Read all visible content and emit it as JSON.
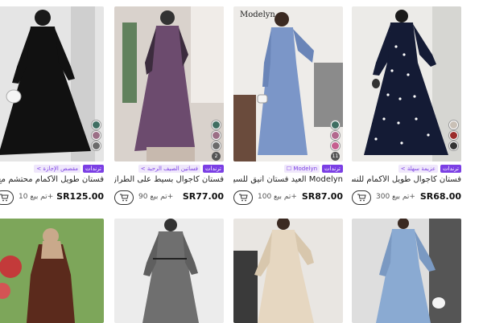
{
  "products": [
    {
      "title": "فستان طويل الأكمام محتشم مع طا...",
      "price": "SR125.00",
      "sold": "تم بيع 10+",
      "tags": [
        "ترندات",
        "مقصص الإجازة >"
      ],
      "swatch_colors": [
        "#3f6e62",
        "#9b6f86",
        "#6b6b6b"
      ],
      "more_label": "",
      "colors": {
        "bg": "#e5e5e5",
        "dress": "#111111"
      }
    },
    {
      "title": "فستان كاجوال بسيط على الطراز العربي...",
      "price": "SR77.00",
      "sold": "تم بيع 90+",
      "tags": [
        "ترندات",
        "فساتين الصيف الرحبة >"
      ],
      "swatch_colors": [
        "#3f6e62",
        "#9b6f86",
        "#6b6b6b"
      ],
      "more_label": "2",
      "colors": {
        "bg": "#d9d2cc",
        "dress": "#6c4b6e"
      }
    },
    {
      "title": "Modelyn العيد فستان أنيق للسيدات بـ...",
      "price": "SR87.00",
      "sold": "تم بيع 100+",
      "tags": [
        "ترندات",
        "Modelyn ☐"
      ],
      "swatch_colors": [
        "#3f6e62",
        "#b2698e",
        "#c55f8f"
      ],
      "more_label": "11",
      "brand_logo": "Modelyn",
      "colors": {
        "bg": "#eeece9",
        "dress": "#7b96c8"
      }
    },
    {
      "title": "فستان كاجوال طويل الأكمام للنساء ...",
      "price": "SR68.00",
      "sold": "تم بيع 300+",
      "tags": [
        "ترندات",
        "عزيمة سهلة >"
      ],
      "swatch_colors": [
        "#c9c0b6",
        "#9b2c2c",
        "#333333"
      ],
      "more_label": "",
      "colors": {
        "bg": "#ecebe8",
        "dress": "#141b35"
      }
    }
  ],
  "row2": [
    {
      "colors": {
        "bg": "#7da65a",
        "dress": "#5b2a1c"
      }
    },
    {
      "colors": {
        "bg": "#ececec",
        "dress": "#6f6f6f"
      }
    },
    {
      "colors": {
        "bg": "#e9e6e2",
        "dress": "#e6d7c1"
      }
    },
    {
      "colors": {
        "bg": "#dedede",
        "dress": "#8aaad2"
      }
    }
  ]
}
